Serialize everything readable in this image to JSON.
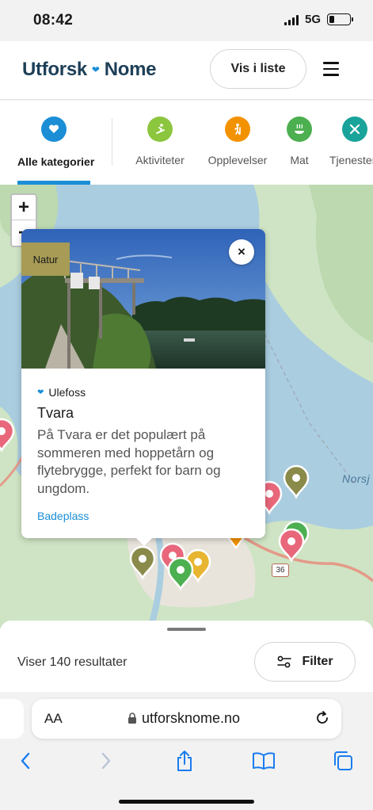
{
  "status": {
    "time": "08:42",
    "network": "5G",
    "battery_level": 0.25
  },
  "header": {
    "logo_part1": "Utforsk",
    "logo_part2": "Nome",
    "list_button": "Vis i liste"
  },
  "categories": {
    "items": [
      {
        "label": "Alle kategorier",
        "icon": "heart-icon",
        "color": "#1b8ed6",
        "active": true
      },
      {
        "label": "Aktiviteter",
        "icon": "skier-icon",
        "color": "#8cc63f"
      },
      {
        "label": "Opplevelser",
        "icon": "hiker-icon",
        "color": "#f39200"
      },
      {
        "label": "Mat",
        "icon": "dish-icon",
        "color": "#4caf50"
      },
      {
        "label": "Tjenester",
        "icon": "tools-icon",
        "color": "#1aa39a"
      }
    ]
  },
  "map": {
    "zoom_in": "+",
    "zoom_out": "−",
    "lake_label": "Norsj",
    "road_number": "36"
  },
  "popup": {
    "badge": "Natur",
    "location": "Ulefoss",
    "title": "Tvara",
    "description": "På Tvara er det populært på sommeren med hoppetårn og flytebrygge, perfekt for barn og ungdom.",
    "link": "Badeplass",
    "close": "×"
  },
  "bottom": {
    "results": "Viser 140 resultater",
    "filter": "Filter"
  },
  "browser": {
    "aa": "AA",
    "url": "utforsknome.no"
  },
  "colors": {
    "accent": "#1b8ed6",
    "logo": "#1d3f58",
    "badge_natur": "#a79b55",
    "map_land": "#cfe4c4",
    "map_water": "#aacde0"
  }
}
